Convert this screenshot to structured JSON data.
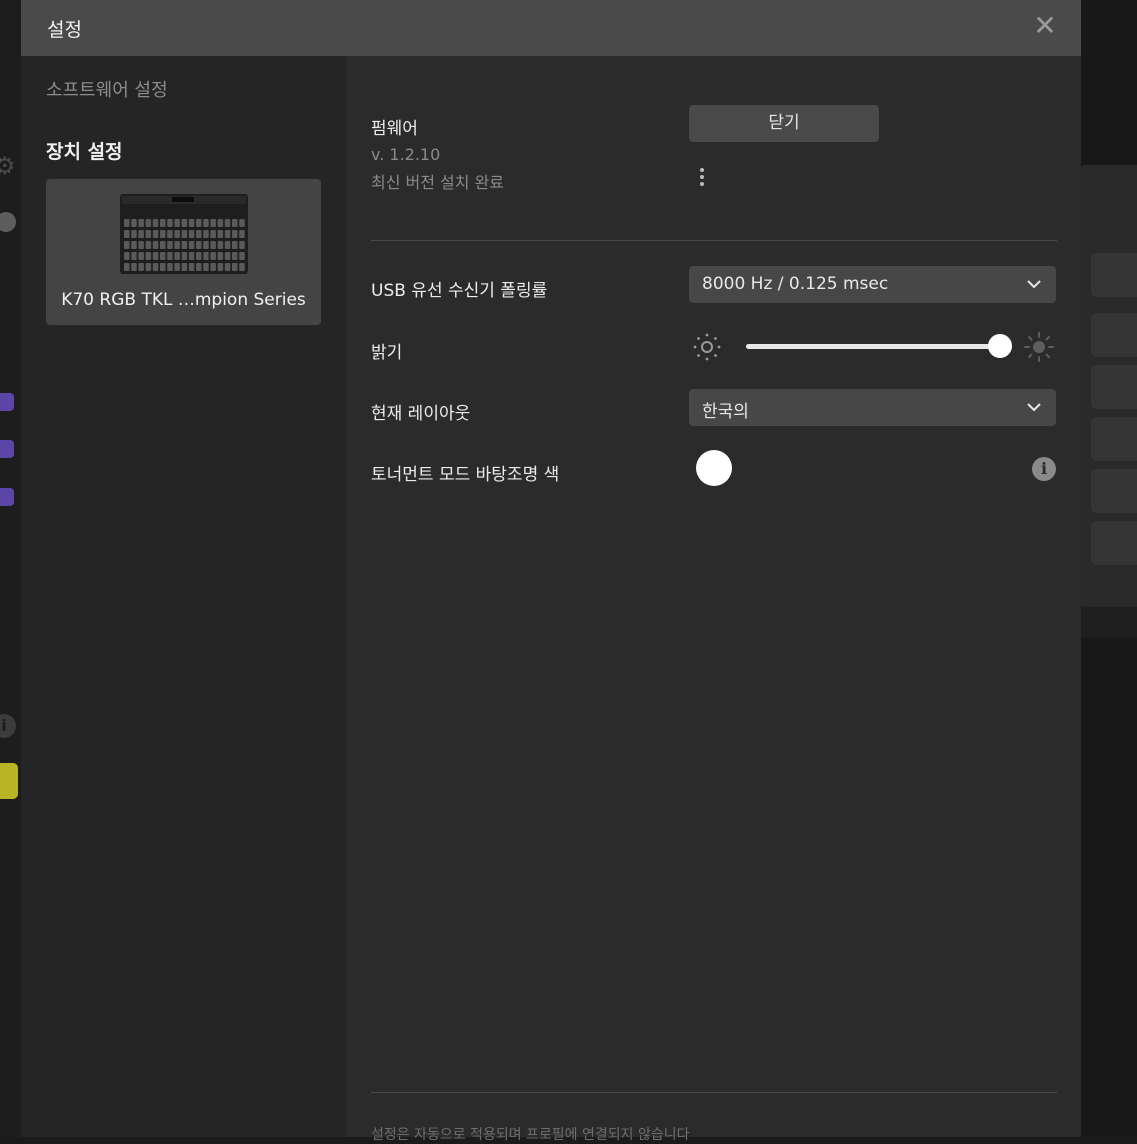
{
  "dialog": {
    "title": "설정"
  },
  "sidebar": {
    "software_settings": "소프트웨어 설정",
    "device_settings": "장치 설정",
    "device_name": "K70 RGB TKL …mpion Series"
  },
  "firmware": {
    "label": "펌웨어",
    "version": "v. 1.2.10",
    "status": "최신 버전 설치 완료",
    "button_label": "닫기"
  },
  "polling": {
    "label": "USB 유선 수신기 폴링률",
    "value": "8000 Hz / 0.125 msec"
  },
  "brightness": {
    "label": "밝기",
    "level_fraction": 1.0
  },
  "layout": {
    "label": "현재 레이아웃",
    "value": "한국의"
  },
  "tournament": {
    "label": "토너먼트 모드 바탕조명 색",
    "color": "#ffffff"
  },
  "footer": {
    "note": "설정은 자동으로 적용되며 프로필에 연결되지 않습니다"
  },
  "colors": {
    "titlebar": "#4a4a4a",
    "panel": "#2b2b2b",
    "sidebar": "#252525",
    "accent_background_purple": "#5b46a8",
    "accent_background_yellow": "#b9b426"
  },
  "icons": [
    "close-icon",
    "kebab-menu-icon",
    "chevron-down-icon",
    "brightness-low-icon",
    "brightness-high-icon",
    "info-icon",
    "keyboard-image"
  ]
}
